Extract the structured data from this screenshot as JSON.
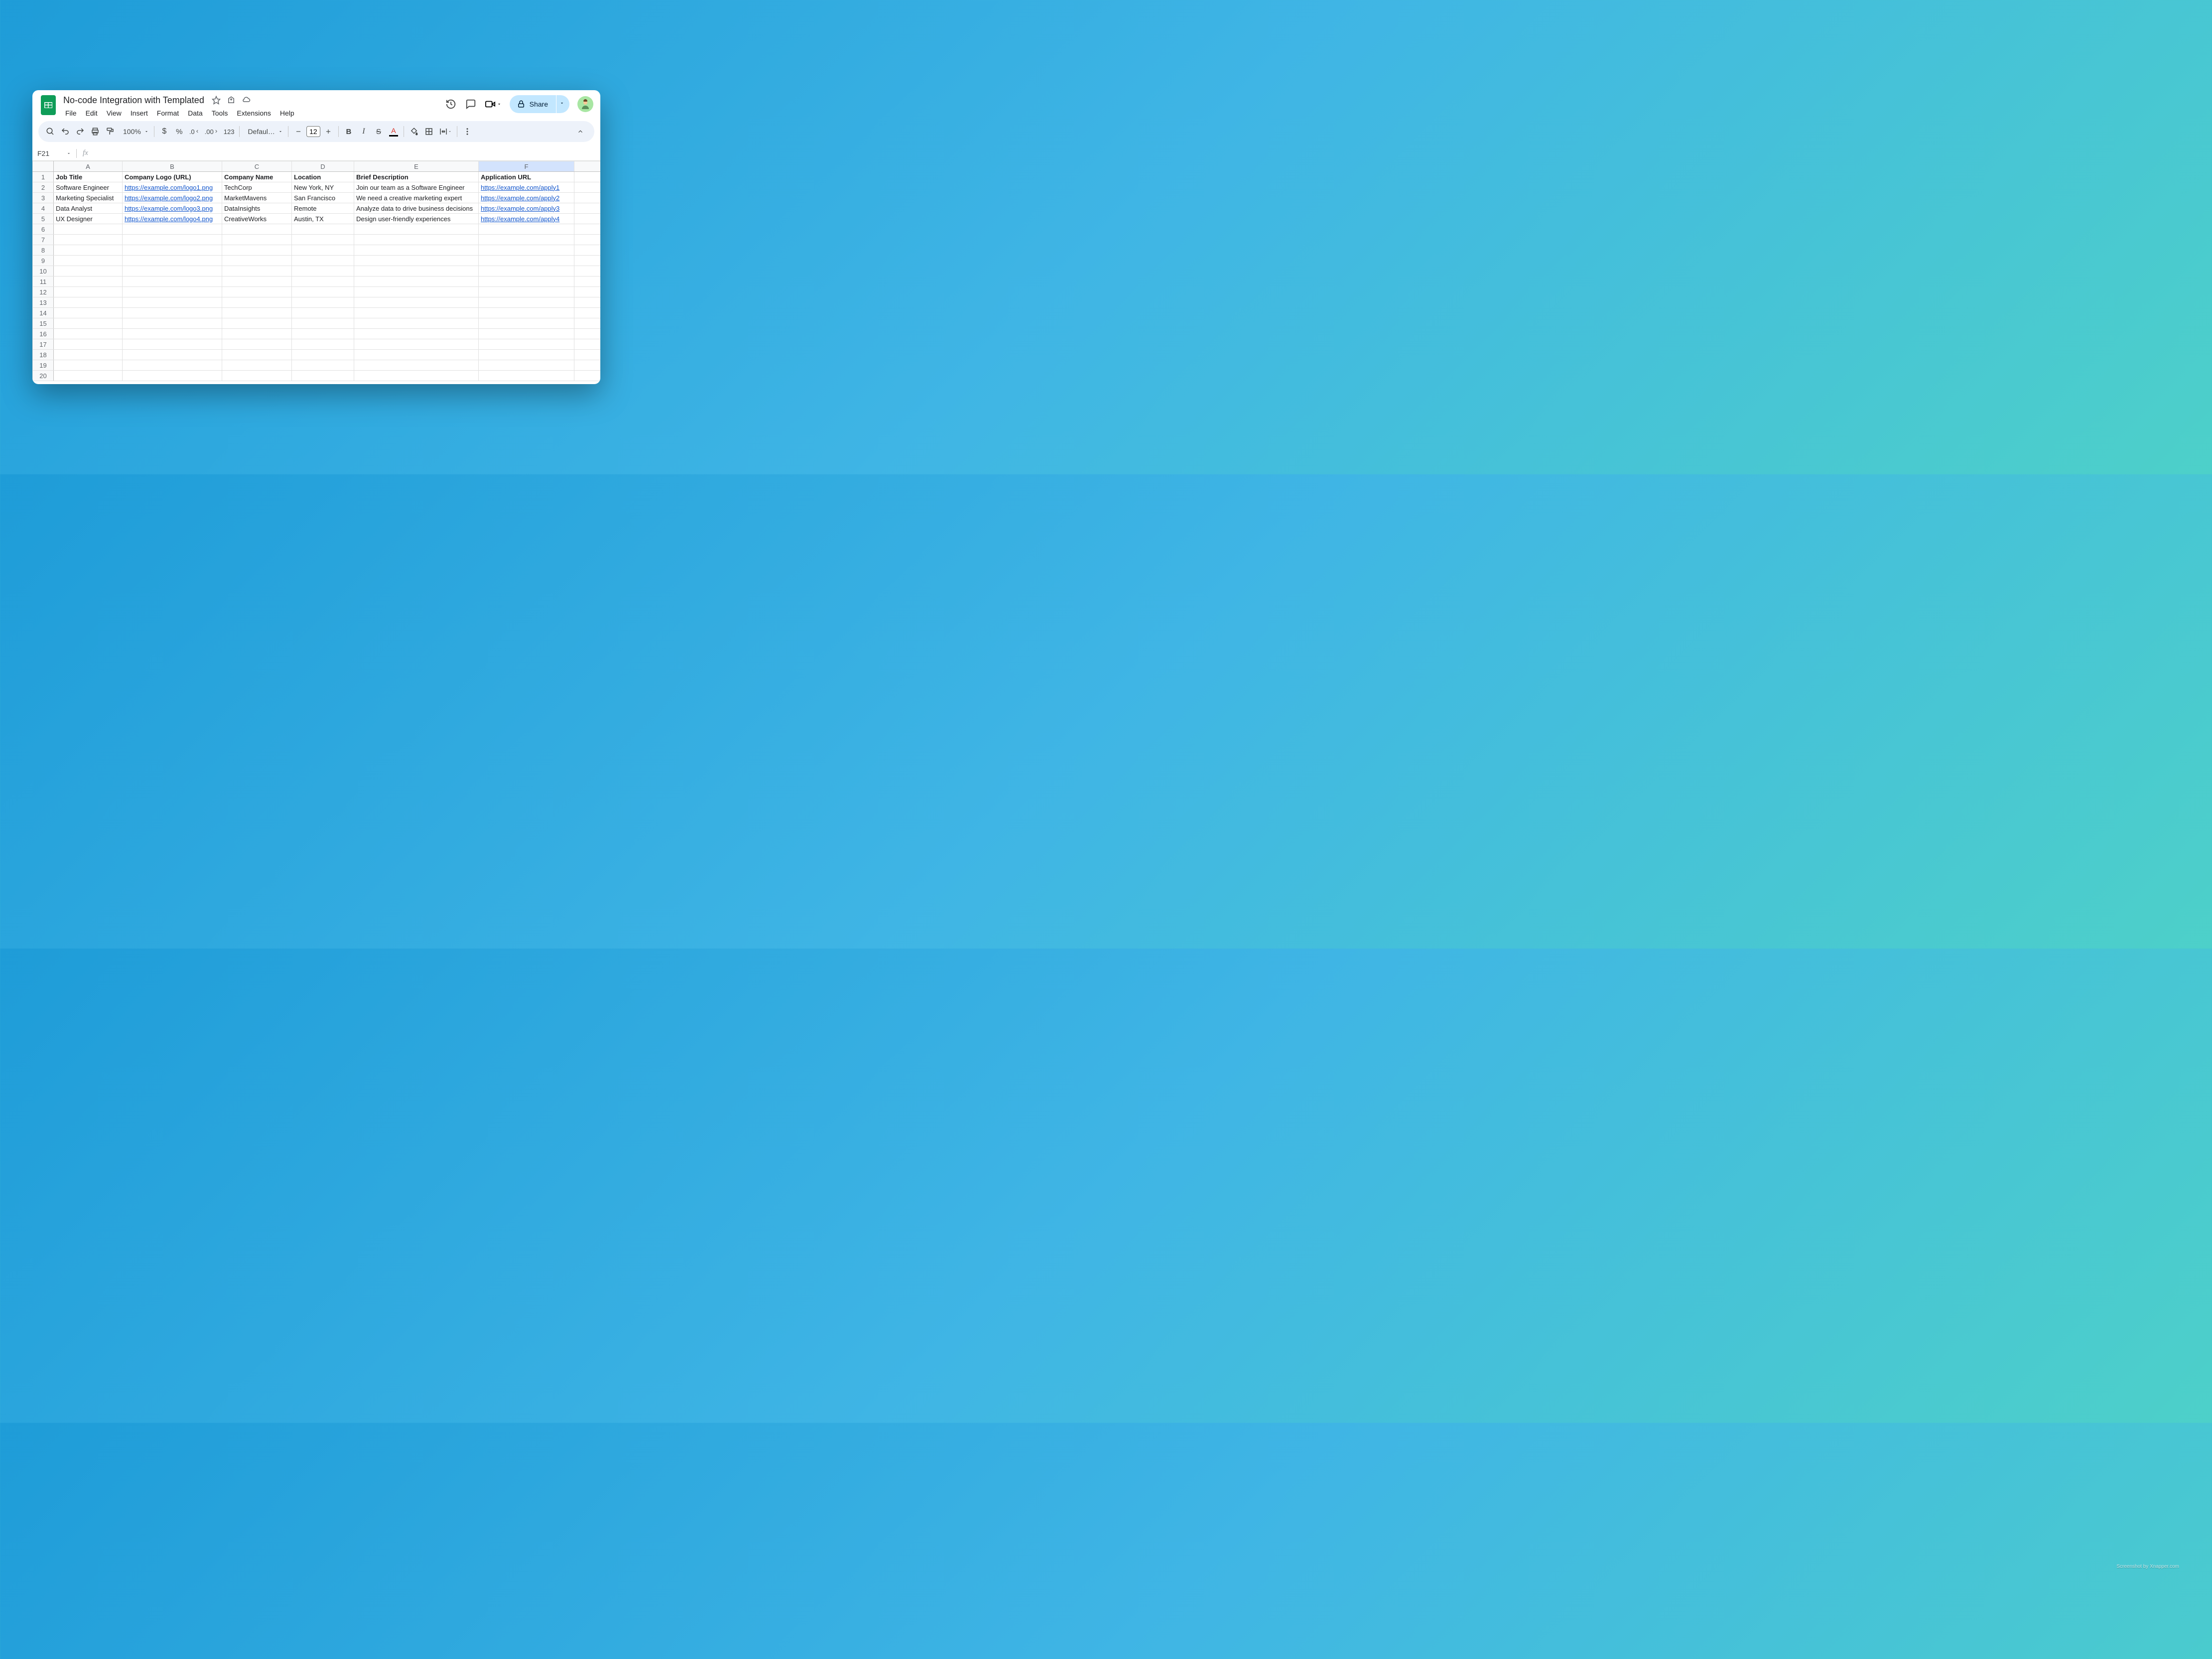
{
  "doc": {
    "title": "No-code Integration with Templated"
  },
  "menubar": [
    "File",
    "Edit",
    "View",
    "Insert",
    "Format",
    "Data",
    "Tools",
    "Extensions",
    "Help"
  ],
  "toolbar": {
    "zoom": "100%",
    "font": "Defaul…",
    "font_size": "12"
  },
  "share": {
    "label": "Share"
  },
  "formula": {
    "cell_ref": "F21",
    "value": ""
  },
  "columns": [
    "A",
    "B",
    "C",
    "D",
    "E",
    "F"
  ],
  "headers": [
    "Job Title",
    "Company Logo (URL)",
    "Company Name",
    "Location",
    "Brief Description",
    "Application URL"
  ],
  "rows": [
    {
      "job": "Software Engineer",
      "logo": "https://example.com/logo1.png",
      "company": "TechCorp",
      "location": "New York, NY",
      "desc": "Join our team as a Software Engineer",
      "apply": "https://example.com/apply1"
    },
    {
      "job": "Marketing Specialist",
      "logo": "https://example.com/logo2.png",
      "company": "MarketMavens",
      "location": "San Francisco",
      "desc": "We need a creative marketing expert",
      "apply": "https://example.com/apply2"
    },
    {
      "job": "Data Analyst",
      "logo": "https://example.com/logo3.png",
      "company": "DataInsights",
      "location": "Remote",
      "desc": "Analyze data to drive business decisions",
      "apply": "https://example.com/apply3"
    },
    {
      "job": "UX Designer",
      "logo": "https://example.com/logo4.png",
      "company": "CreativeWorks",
      "location": "Austin, TX",
      "desc": "Design user-friendly experiences",
      "apply": "https://example.com/apply4"
    }
  ],
  "blank_rows": 20,
  "selected_col": "F",
  "watermark": "Screenshot by Xnapper.com"
}
